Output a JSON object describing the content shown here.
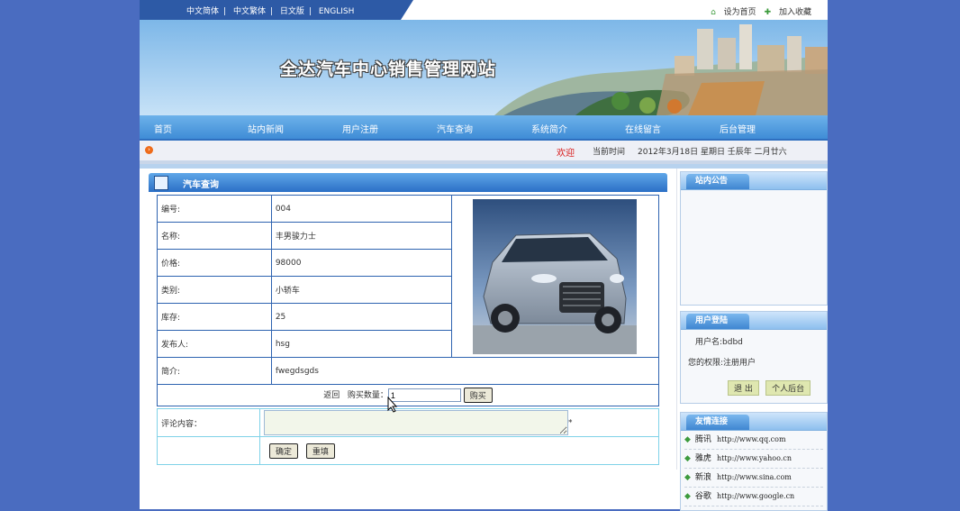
{
  "lang_bar": [
    "中文简体",
    "中文繁体",
    "日文版",
    "ENGLISH"
  ],
  "top_links": {
    "home": "设为首页",
    "fav": "加入收藏"
  },
  "site_title": "全达汽车中心销售管理网站",
  "nav": [
    "首页",
    "站内新闻",
    "用户注册",
    "汽车查询",
    "系统简介",
    "在线留言",
    "后台管理"
  ],
  "infobar": {
    "welcome": "欢迎",
    "time_label": "当前时间",
    "date": "2012年3月18日 星期日 壬辰年 二月廿六"
  },
  "section_title": "汽车查询",
  "detail": [
    {
      "label": "编号:",
      "value": "004"
    },
    {
      "label": "名称:",
      "value": "丰男骏力士"
    },
    {
      "label": "价格:",
      "value": "98000"
    },
    {
      "label": "类别:",
      "value": "小轿车"
    },
    {
      "label": "库存:",
      "value": "25"
    },
    {
      "label": "发布人:",
      "value": "hsg"
    },
    {
      "label": "简介:",
      "value": "fwegdsgds"
    }
  ],
  "buy": {
    "back": "返回",
    "qty_label": "购买数量：",
    "qty_value": "1",
    "buy_button": "购买"
  },
  "comment": {
    "label": "评论内容：",
    "required": "*",
    "confirm": "确定",
    "reset": "重填"
  },
  "sidebar": {
    "notice_title": "站内公告",
    "login_title": "用户登陆",
    "username": "用户名:bdbd",
    "permission": "您的权限:注册用户",
    "logout": "退 出",
    "backend": "个人后台",
    "links_title": "友情连接",
    "links": [
      {
        "name": "腾讯",
        "url": "http://www.qq.com"
      },
      {
        "name": "雅虎",
        "url": "http://www.yahoo.cn"
      },
      {
        "name": "新浪",
        "url": "http://www.sina.com"
      },
      {
        "name": "谷歌",
        "url": "http://www.google.cn"
      }
    ]
  }
}
